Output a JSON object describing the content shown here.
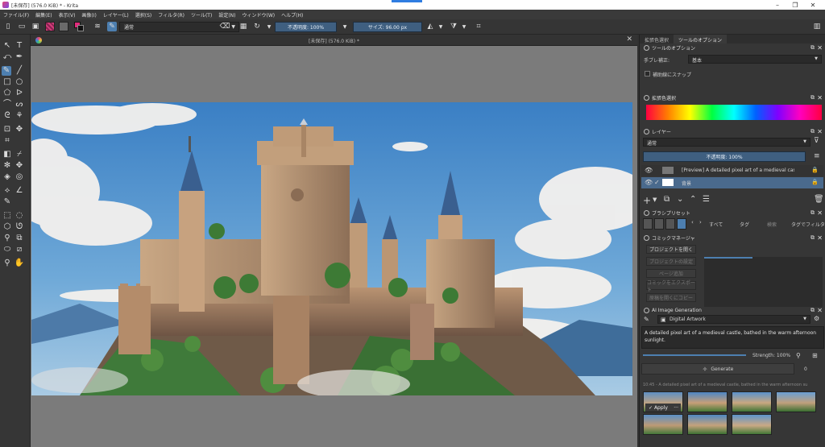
{
  "window": {
    "title": "[未保存] (576.0 KiB) * - Krita",
    "controls": [
      "–",
      "❐",
      "✕"
    ]
  },
  "menu": [
    "ファイル(F)",
    "編集(E)",
    "表示(V)",
    "画像(I)",
    "レイヤー(L)",
    "選択(S)",
    "フィルタ(R)",
    "ツール(T)",
    "設定(N)",
    "ウィンドウ(W)",
    "ヘルプ(H)"
  ],
  "toolbar": {
    "blend_mode": "通常",
    "opacity_label": "不透明度: 100%",
    "size_label": "サイズ: 96.00 px",
    "accent": "#3f5f80"
  },
  "document": {
    "tab_title": "[未保存] (576.0 KiB) *"
  },
  "dock_tabs": [
    "拡張色選択",
    "ツールのオプション"
  ],
  "tool_options": {
    "title": "ツールのオプション",
    "mode_label": "手ブレ補正:",
    "mode_value": "基本",
    "snap_label": "補助線にスナップ"
  },
  "color_selector": {
    "title": "拡張色選択"
  },
  "layers": {
    "title": "レイヤー",
    "blend": "通常",
    "opacity": "不透明度: 100%",
    "items": [
      {
        "name": "[Preview] A detailed pixel art of a medieval castle, bath...",
        "selected": false
      },
      {
        "name": "背景",
        "selected": true
      }
    ]
  },
  "brush_presets": {
    "title": "ブラシプリセット",
    "filter_all": "すべて",
    "tag_label": "タグ",
    "search_label": "検索",
    "tag_filter": "タグでフィルタ"
  },
  "comic": {
    "title": "コミックマネージャ",
    "buttons": [
      "プロジェクトを開く",
      "プロジェクトの設定",
      "ページ追加",
      "コミックをエクスポート",
      "原稿を開くにコピー"
    ]
  },
  "ai": {
    "title": "AI Image Generation",
    "workspace": "Digital Artwork",
    "prompt": "A detailed pixel art of a medieval castle, bathed in the warm afternoon sunlight.",
    "strength_label": "Strength: 100%",
    "generate_label": "Generate",
    "seed_label": "0",
    "history_caption": "10:45 - A detailed pixel art of a medieval castle, bathed in the warm afternoon su",
    "apply_label": "Apply",
    "more_label": "..."
  }
}
